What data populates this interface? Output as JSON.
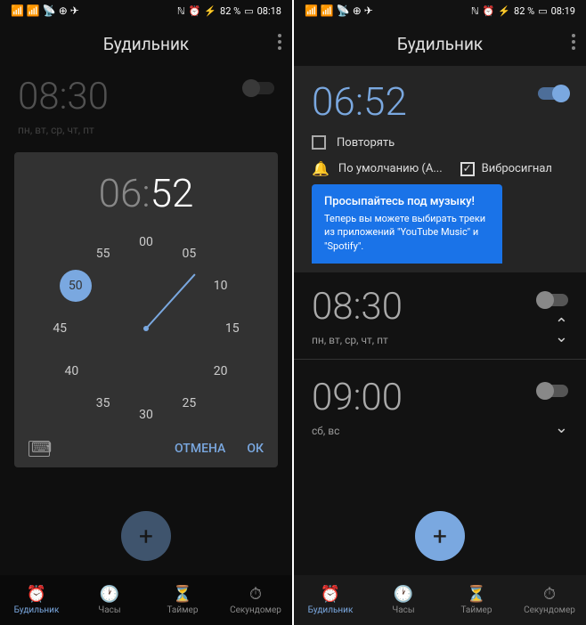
{
  "left": {
    "status": {
      "battery": "82 %",
      "time": "08:18"
    },
    "header": {
      "title": "Будильник"
    },
    "dimmed_alarm": {
      "time": "08:30",
      "days": "пн, вт, ср, чт, пт"
    },
    "picker": {
      "hour": "06",
      "sep": ":",
      "minute": "52",
      "numbers": [
        "00",
        "05",
        "10",
        "15",
        "20",
        "25",
        "30",
        "35",
        "40",
        "45",
        "50",
        "55"
      ],
      "selected": "50",
      "cancel": "ОТМЕНА",
      "ok": "ОК"
    },
    "nav": {
      "alarm": "Будильник",
      "clock": "Часы",
      "timer": "Таймер",
      "stopwatch": "Секундомер"
    }
  },
  "right": {
    "status": {
      "battery": "82 %",
      "time": "08:19"
    },
    "header": {
      "title": "Будильник"
    },
    "expanded": {
      "time": "06:52",
      "repeat": "Повторять",
      "sound": "По умолчанию (A...",
      "vibrate": "Вибросигнал",
      "tooltip_title": "Просыпайтесь под музыку!",
      "tooltip_text": "Теперь вы можете выбирать треки из приложений \"YouTube Music\" и \"Spotify\"."
    },
    "alarm2": {
      "time": "08:30",
      "days": "пн, вт, ср, чт, пт"
    },
    "alarm3": {
      "time": "09:00",
      "days": "сб, вс"
    },
    "nav": {
      "alarm": "Будильник",
      "clock": "Часы",
      "timer": "Таймер",
      "stopwatch": "Секундомер"
    }
  }
}
